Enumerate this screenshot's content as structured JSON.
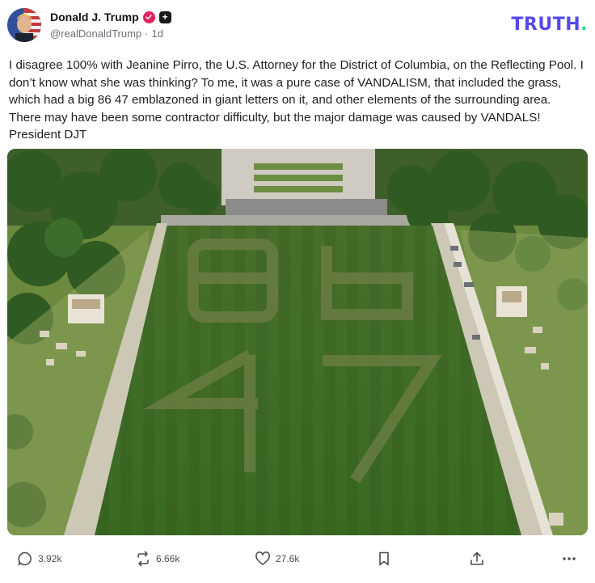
{
  "post": {
    "author_name": "Donald J. Trump",
    "handle": "@realDonaldTrump",
    "separator": "·",
    "age": "1d",
    "body": "I disagree 100% with Jeanine Pirro, the U.S. Attorney for the District of Columbia, on the Reflecting Pool. I don’t know what she was thinking? To me, it was a pure case of VANDALISM, that included the grass, which had a big 86 47 emblazoned in giant letters on it, and other elements of the surrounding area. There may have been some contractor difficulty, but the major damage was caused by VANDALS! President DJT",
    "plus_badge": "+"
  },
  "brand": {
    "logo_text": "TRUTH",
    "logo_dot": ".",
    "logo_color": "#5448ee",
    "dot_color": "#31d4b3"
  },
  "photo": {
    "subject": "aerial view of grass lawn with faded 86 47 letters",
    "lawn_text": "86 47"
  },
  "actions": {
    "reply_count": "3.92k",
    "retruth_count": "6.66k",
    "like_count": "27.6k"
  },
  "icons": {
    "verified": "verified-check-icon",
    "reply": "reply-bubble-icon",
    "retruth": "retruth-arrows-icon",
    "like": "heart-icon",
    "bookmark": "bookmark-icon",
    "share": "share-upload-icon",
    "more": "more-dots-icon"
  }
}
